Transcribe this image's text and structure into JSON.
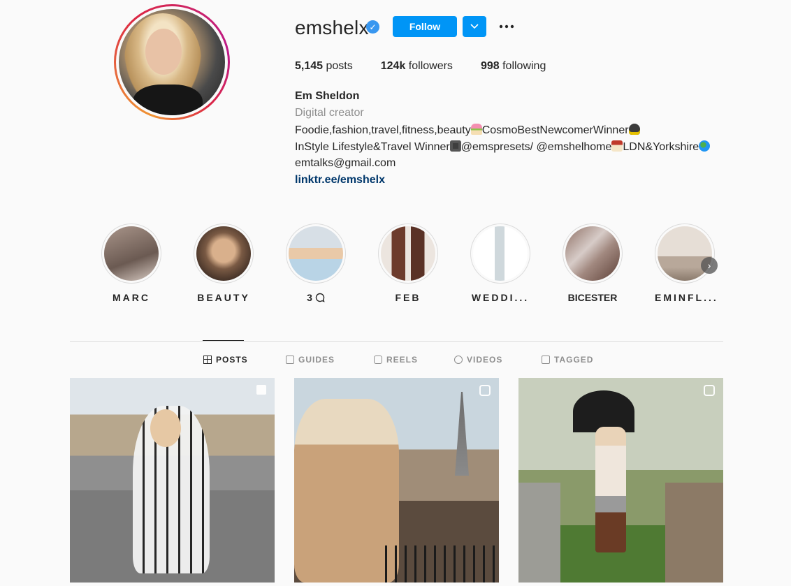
{
  "profile": {
    "username": "emshelx",
    "verified_icon": "verified-badge-icon",
    "follow_label": "Follow",
    "stats": {
      "posts_count": "5,145",
      "posts_label": "posts",
      "followers_count": "124k",
      "followers_label": "followers",
      "following_count": "998",
      "following_label": "following"
    },
    "full_name": "Em Sheldon",
    "category": "Digital creator",
    "bio_line1_a": "Foodie,fashion,travel,fitness,beauty",
    "bio_line1_b": "CosmoBestNewcomerWinner",
    "bio_line2_a": "InStyle Lifestyle&Travel Winner",
    "bio_line2_b": "@emspresets/ @emshelhome",
    "bio_line2_c": "LDN&Yorkshire",
    "bio_line3": "emtalks@gmail.com",
    "link": "linktr.ee/emshelx"
  },
  "highlights": [
    {
      "label": "MARC"
    },
    {
      "label": "BEAUTY"
    },
    {
      "label": "3"
    },
    {
      "label": "FEB"
    },
    {
      "label": "WEDDI..."
    },
    {
      "label": "BICESTER"
    },
    {
      "label": "EMINFL..."
    }
  ],
  "tabs": [
    {
      "label": "POSTS",
      "icon": "grid-icon",
      "active": true
    },
    {
      "label": "GUIDES",
      "icon": "guide-icon",
      "active": false
    },
    {
      "label": "REELS",
      "icon": "reels-icon",
      "active": false
    },
    {
      "label": "VIDEOS",
      "icon": "play-icon",
      "active": false
    },
    {
      "label": "TAGGED",
      "icon": "tagged-icon",
      "active": false
    }
  ],
  "posts": [
    {
      "badge": "carousel-icon"
    },
    {
      "badge": "reel-icon"
    },
    {
      "badge": "reel-icon"
    }
  ],
  "colors": {
    "accent": "#0095f6",
    "link": "#00376b",
    "muted": "#8e8e8e",
    "verified": "#3897f0"
  }
}
